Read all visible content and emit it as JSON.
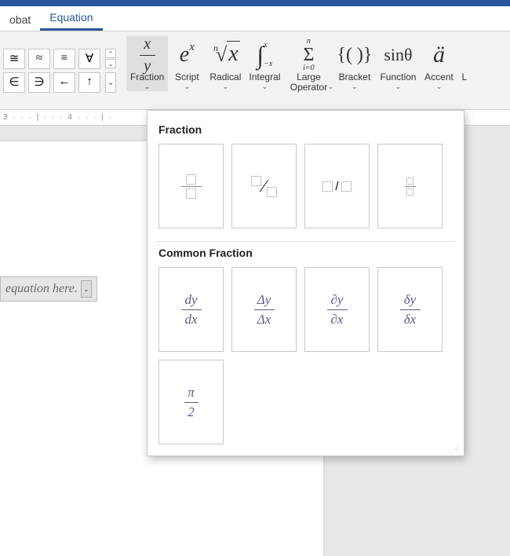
{
  "tabs": {
    "t0": "obat",
    "t1": "Equation"
  },
  "symbols": {
    "r0": [
      "≅",
      "≈",
      "≡",
      "∀"
    ],
    "r1": [
      "∈",
      "∋",
      "←",
      "↑"
    ]
  },
  "structures": {
    "fraction": "Fraction",
    "script": "Script",
    "radical": "Radical",
    "integral": "Integral",
    "largeop": "Large\nOperator",
    "bracket": "Bracket",
    "function": "Function",
    "accent": "Accent",
    "limit_partial": "L"
  },
  "ruler_text": "3 · · · | · · · 4 · · · | ·",
  "equation_placeholder": "equation here.",
  "gallery": {
    "section1": "Fraction",
    "section2": "Common Fraction",
    "common": [
      {
        "num": "dy",
        "den": "dx"
      },
      {
        "num": "Δy",
        "den": "Δx"
      },
      {
        "num": "∂y",
        "den": "∂x"
      },
      {
        "num": "δy",
        "den": "δx"
      },
      {
        "num": "π",
        "den": "2"
      }
    ]
  },
  "chevron": "⌄",
  "up_caret": "⌃",
  "resize": ".:"
}
